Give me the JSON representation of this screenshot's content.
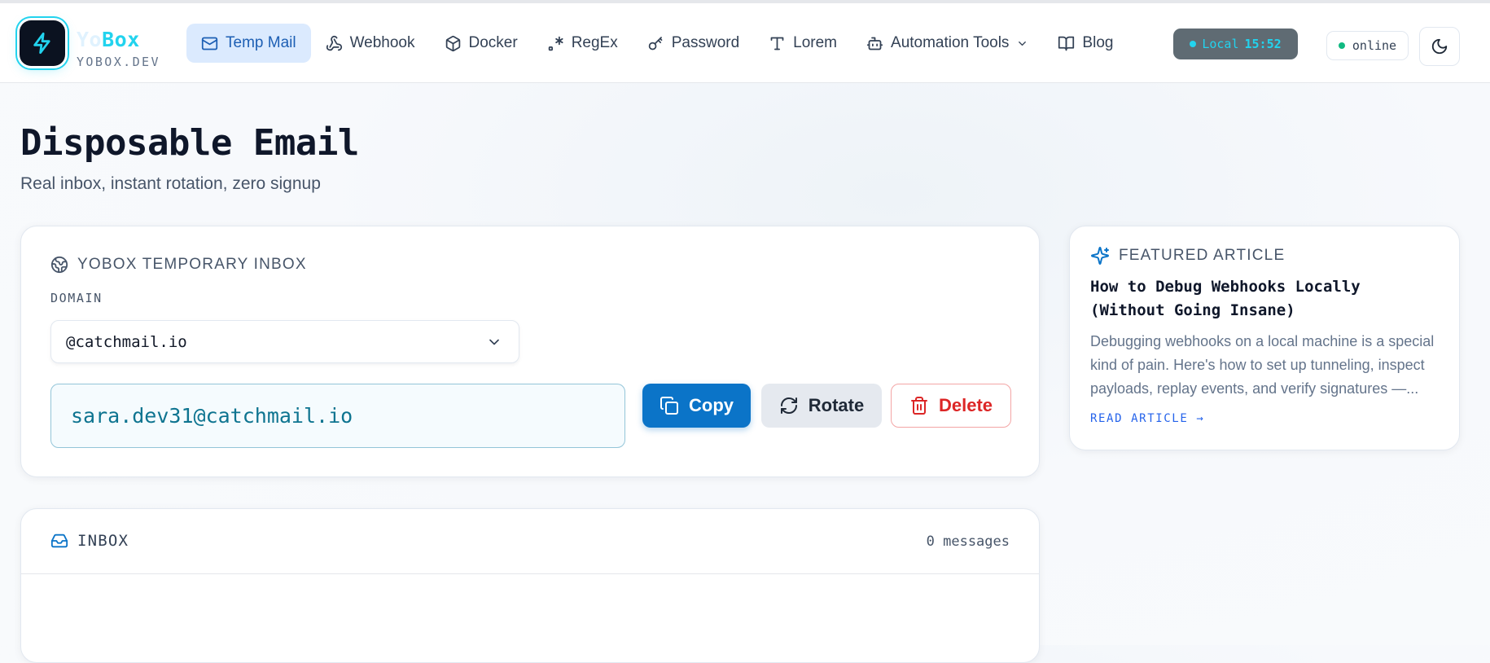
{
  "brand": {
    "name_prefix": "Yo",
    "name_accent": "Box",
    "domain": "YOBOX.DEV"
  },
  "nav": {
    "items": [
      {
        "label": "Temp Mail",
        "icon": "mail-icon",
        "active": true
      },
      {
        "label": "Webhook",
        "icon": "webhook-icon"
      },
      {
        "label": "Docker",
        "icon": "box-icon"
      },
      {
        "label": "RegEx",
        "icon": "regex-icon"
      },
      {
        "label": "Password",
        "icon": "key-icon"
      },
      {
        "label": "Lorem",
        "icon": "type-icon"
      },
      {
        "label": "Automation Tools",
        "icon": "bot-icon",
        "has_dropdown": true
      },
      {
        "label": "Blog",
        "icon": "book-icon"
      }
    ]
  },
  "clock": {
    "label": "Local",
    "time": "15:52"
  },
  "status": {
    "label": "online"
  },
  "theme_toggle": {
    "icon": "moon-icon"
  },
  "page": {
    "title": "Disposable Email",
    "subtitle": "Real inbox, instant rotation, zero signup"
  },
  "inbox_card": {
    "heading": "YOBOX TEMPORARY INBOX",
    "domain_label": "DOMAIN",
    "domain_value": "@catchmail.io",
    "email": "sara.dev31@catchmail.io",
    "buttons": {
      "copy": "Copy",
      "rotate": "Rotate",
      "delete": "Delete"
    }
  },
  "messages_card": {
    "heading": "INBOX",
    "count": "0 messages"
  },
  "featured": {
    "kicker": "FEATURED ARTICLE",
    "title": "How to Debug Webhooks Locally (Without Going Insane)",
    "excerpt": "Debugging webhooks on a local machine is a special kind of pain. Here's how to set up tunneling, inspect payloads, replay events, and verify signatures —...",
    "link": "READ ARTICLE →"
  },
  "colors": {
    "accent": "#22d3ee",
    "primary": "#0b74c8",
    "danger": "#dc2626",
    "online": "#10b981"
  }
}
